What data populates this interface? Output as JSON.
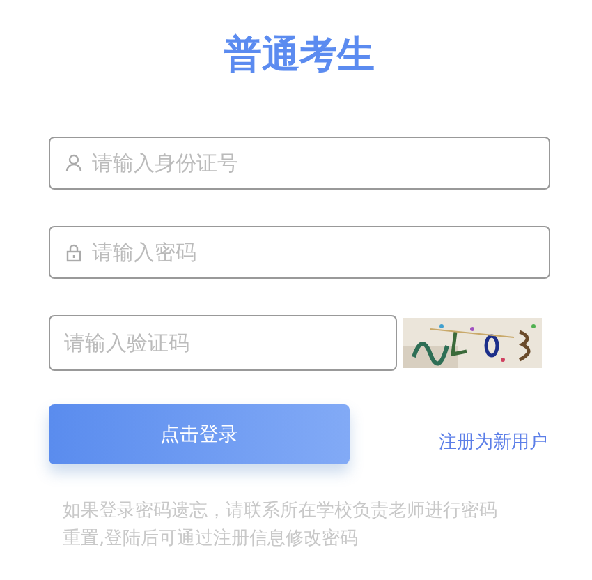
{
  "title": "普通考生",
  "fields": [
    {
      "kind": "user",
      "placeholder": "请输入身份证号"
    },
    {
      "kind": "lock",
      "placeholder": "请输入密码"
    }
  ],
  "captcha": {
    "placeholder": "请输入验证码"
  },
  "login_button": "点击登录",
  "register_link": "注册为新用户",
  "help_text": "如果登录密码遗忘，请联系所在学校负责老师进行密码重置,登陆后可通过注册信息修改密码"
}
